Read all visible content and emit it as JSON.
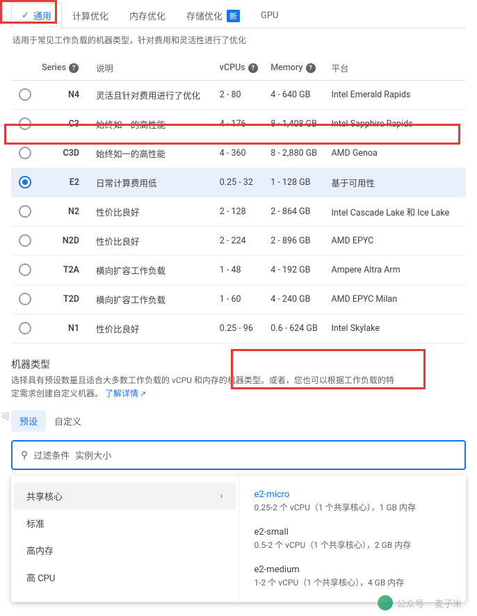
{
  "tabs": {
    "general": "通用",
    "compute": "计算优化",
    "memory": "内存优化",
    "storage": "存储优化",
    "storage_new_badge": "新",
    "gpu": "GPU"
  },
  "tabs_desc": "适用于常见工作负载的机器类型，针对费用和灵活性进行了优化",
  "table_headers": {
    "series": "Series",
    "desc": "说明",
    "vcpu": "vCPUs",
    "memory": "Memory",
    "platform": "平台"
  },
  "rows": [
    {
      "series": "N4",
      "desc": "灵活且针对费用进行了优化",
      "vcpu": "2 - 80",
      "mem": "4 - 640 GB",
      "plat": "Intel Emerald Rapids"
    },
    {
      "series": "C3",
      "desc": "始终如一的高性能",
      "vcpu": "4 - 176",
      "mem": "8 - 1,408 GB",
      "plat": "Intel Sapphire Rapids"
    },
    {
      "series": "C3D",
      "desc": "始终如一的高性能",
      "vcpu": "4 - 360",
      "mem": "8 - 2,880 GB",
      "plat": "AMD Genoa"
    },
    {
      "series": "E2",
      "desc": "日常计算费用低",
      "vcpu": "0.25 - 32",
      "mem": "1 - 128 GB",
      "plat": "基于可用性"
    },
    {
      "series": "N2",
      "desc": "性价比良好",
      "vcpu": "2 - 128",
      "mem": "2 - 864 GB",
      "plat": "Intel Cascade Lake 和 Ice Lake"
    },
    {
      "series": "N2D",
      "desc": "性价比良好",
      "vcpu": "2 - 224",
      "mem": "2 - 896 GB",
      "plat": "AMD EPYC"
    },
    {
      "series": "T2A",
      "desc": "横向扩容工作负载",
      "vcpu": "1 - 48",
      "mem": "4 - 192 GB",
      "plat": "Ampere Altra Arm"
    },
    {
      "series": "T2D",
      "desc": "横向扩容工作负载",
      "vcpu": "1 - 60",
      "mem": "4 - 240 GB",
      "plat": "AMD EPYC Milan"
    },
    {
      "series": "N1",
      "desc": "性价比良好",
      "vcpu": "0.25 - 96",
      "mem": "0.6 - 624 GB",
      "plat": "Intel Skylake"
    }
  ],
  "selected_row_index": 3,
  "machine_type": {
    "title": "机器类型",
    "desc_a": "选择具有预设数量且适合大多数工作负载的 vCPU 和内存的机器类型。或者，您也可以根据工作负载的特定需求创建自定义机器。",
    "learn_more": "了解详情"
  },
  "subtabs": {
    "preset": "预设",
    "custom": "自定义"
  },
  "filter": {
    "label": "过滤条件",
    "placeholder": "实例大小"
  },
  "dd_left": {
    "shared": "共享核心",
    "standard": "标准",
    "highmem": "高内存",
    "highcpu": "高 CPU"
  },
  "mt_options": [
    {
      "name": "e2-micro",
      "spec": "0.25-2 个 vCPU（1 个共享核心），1 GB 内存"
    },
    {
      "name": "e2-small",
      "spec": "0.5-2 个 vCPU（1 个共享核心），2 GB 内存"
    },
    {
      "name": "e2-medium",
      "spec": "1-2 个 vCPU（1 个共享核心），4 GB 内存"
    }
  ],
  "side_letter": "可",
  "watermark": {
    "prefix": "公众号",
    "dot": "·",
    "name": "麦子米"
  }
}
